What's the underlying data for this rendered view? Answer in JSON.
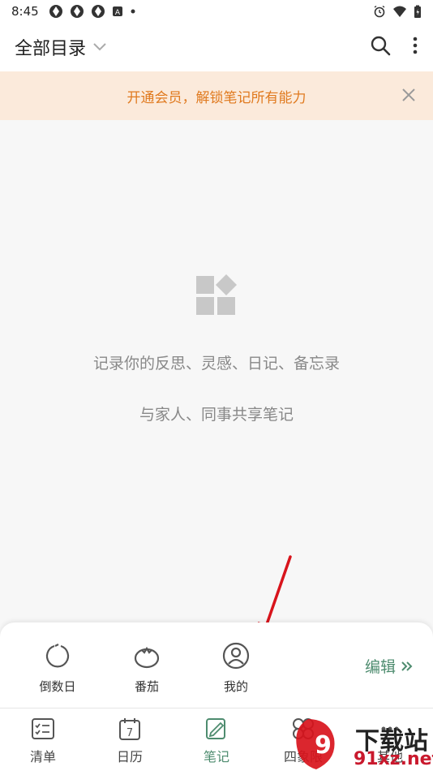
{
  "status_bar": {
    "time": "8:45",
    "left_icons": [
      "app-icon",
      "app-icon",
      "app-icon",
      "a-box-icon",
      "dot-icon"
    ],
    "right_icons": [
      "alarm-icon",
      "wifi-icon",
      "battery-icon"
    ]
  },
  "header": {
    "title": "全部目录",
    "icons": [
      "chevron-down-icon",
      "search-icon",
      "more-vertical-icon"
    ]
  },
  "promo": {
    "text": "开通会员，解锁笔记所有能力",
    "accent": "#e07a1f",
    "background": "#fbeadb"
  },
  "empty_state": {
    "line1": "记录你的反思、灵感、日记、备忘录",
    "line2": "与家人、同事共享笔记"
  },
  "quick_panel": {
    "items": [
      {
        "label": "倒数日",
        "icon": "countdown-icon"
      },
      {
        "label": "番茄",
        "icon": "tomato-icon"
      },
      {
        "label": "我的",
        "icon": "profile-icon"
      }
    ],
    "edit_label": "编辑",
    "edit_color": "#4e8c6f"
  },
  "tabs": [
    {
      "label": "清单",
      "icon": "checklist-icon"
    },
    {
      "label": "日历",
      "icon": "calendar-icon",
      "icon_text": "7"
    },
    {
      "label": "笔记",
      "icon": "note-icon",
      "active": true
    },
    {
      "label": "四象限",
      "icon": "quadrant-icon"
    },
    {
      "label": "其他",
      "icon": "other-icon"
    }
  ],
  "watermark": {
    "text": "下载站",
    "subtext": "91xz.net"
  }
}
